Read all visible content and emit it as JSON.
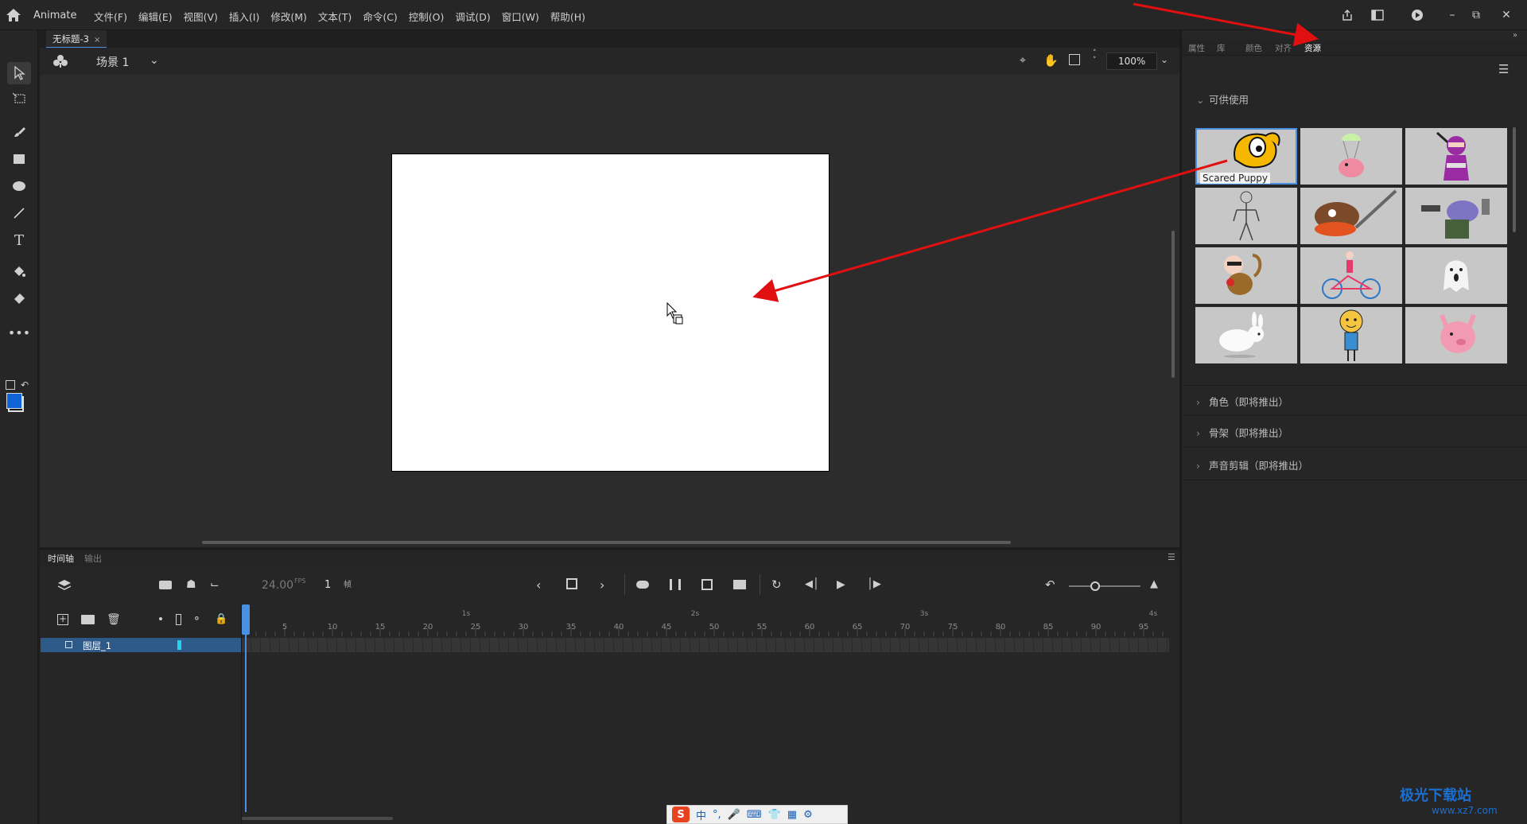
{
  "app": {
    "name": "Animate"
  },
  "menus": [
    "文件(F)",
    "编辑(E)",
    "视图(V)",
    "插入(I)",
    "修改(M)",
    "文本(T)",
    "命令(C)",
    "控制(O)",
    "调试(D)",
    "窗口(W)",
    "帮助(H)"
  ],
  "document_tab": {
    "title": "无标题-3",
    "close": "×"
  },
  "scene": {
    "label": "场景 1"
  },
  "zoom": {
    "value": "100%"
  },
  "timeline": {
    "tabs": [
      "时间轴",
      "输出"
    ],
    "fps": "24.00",
    "fps_unit": "FPS",
    "current_frame": "1",
    "frame_unit": "帧",
    "layer_name": "图层_1",
    "ruler_labels": [
      "5",
      "10",
      "15",
      "20",
      "25",
      "30",
      "35",
      "40",
      "45",
      "50",
      "55",
      "60",
      "65",
      "70",
      "75",
      "80",
      "85",
      "90",
      "95"
    ],
    "second_labels": [
      "1s",
      "2s",
      "3s",
      "4s"
    ]
  },
  "right_panel": {
    "tabs": [
      "属性",
      "库",
      "颜色",
      "对齐",
      "资源"
    ],
    "active_tab": "资源",
    "available_title": "可供使用",
    "assets": [
      {
        "name": "Scared Puppy",
        "icon": "puppy-icon"
      },
      {
        "name": "",
        "icon": "parachute-pig-icon"
      },
      {
        "name": "",
        "icon": "ninja-icon"
      },
      {
        "name": "",
        "icon": "skeleton-icon"
      },
      {
        "name": "",
        "icon": "knight-icon"
      },
      {
        "name": "",
        "icon": "robot-rhino-icon"
      },
      {
        "name": "",
        "icon": "monkey-icon"
      },
      {
        "name": "",
        "icon": "bicycle-girl-icon"
      },
      {
        "name": "",
        "icon": "ghost-icon"
      },
      {
        "name": "",
        "icon": "rabbit-icon"
      },
      {
        "name": "",
        "icon": "boy-icon"
      },
      {
        "name": "",
        "icon": "pink-pig-icon"
      }
    ],
    "sections": [
      "角色（即将推出）",
      "骨架（即将推出）",
      "声音剪辑（即将推出）"
    ]
  },
  "ime": {
    "logo": "S",
    "lang": "中"
  },
  "watermark": {
    "title": "极光下载站",
    "url": "www.xz7.com"
  },
  "colors": {
    "accent": "#4a90e2",
    "annotation_arrow": "#e01010",
    "stroke": "#1064d8"
  }
}
